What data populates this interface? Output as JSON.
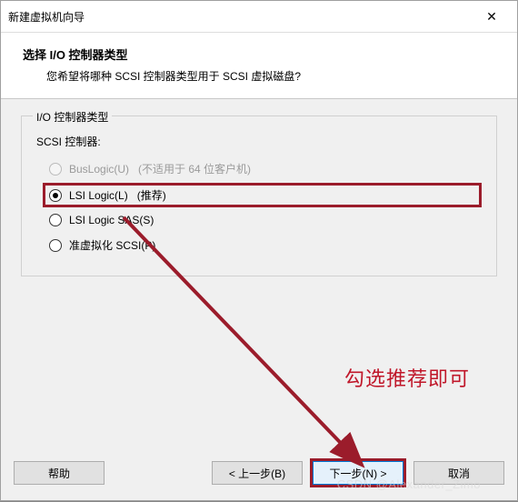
{
  "window": {
    "title": "新建虚拟机向导"
  },
  "header": {
    "title": "选择 I/O 控制器类型",
    "subtitle": "您希望将哪种 SCSI 控制器类型用于 SCSI 虚拟磁盘?"
  },
  "group": {
    "legend": "I/O 控制器类型",
    "scsi_label": "SCSI 控制器:",
    "options": [
      {
        "label": "BusLogic(U)",
        "hint": "(不适用于 64 位客户机)",
        "checked": false,
        "disabled": true
      },
      {
        "label": "LSI Logic(L)",
        "hint": "(推荐)",
        "checked": true,
        "disabled": false
      },
      {
        "label": "LSI Logic SAS(S)",
        "hint": "",
        "checked": false,
        "disabled": false
      },
      {
        "label": "准虚拟化 SCSI(P)",
        "hint": "",
        "checked": false,
        "disabled": false
      }
    ]
  },
  "annotation": {
    "text": "勾选推荐即可"
  },
  "footer": {
    "help": "帮助",
    "back": "< 上一步(B)",
    "next": "下一步(N) >",
    "cancel": "取消"
  },
  "watermark": "CSDN @Alexander_Zimo"
}
